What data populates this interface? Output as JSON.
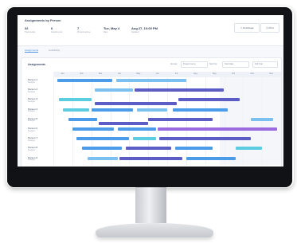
{
  "page_title": "Assignments by Person",
  "stats": [
    {
      "value": "32",
      "label": "Total people"
    },
    {
      "value": "6",
      "label": "Assignments"
    },
    {
      "value": "7",
      "label": "Projects active"
    },
    {
      "value": "Tue, May 4",
      "label": "Date"
    },
    {
      "value": "Aug 27, 10:00 PM",
      "label": "Updated"
    }
  ],
  "buttons": {
    "download": "Download",
    "print": "Print"
  },
  "tabs": [
    {
      "label": "Assignments"
    },
    {
      "label": "Availability"
    }
  ],
  "panel": {
    "title": "Assignments",
    "filter_label_1": "Group",
    "filter_value_1": "Project name",
    "filter_label_2": "Sort by",
    "filter_value_2": "Start date",
    "view_label": "Full Year"
  },
  "months": [
    "Jan",
    "Feb",
    "Mar",
    "Apr",
    "May",
    "Jun",
    "Jul",
    "Aug",
    "Sep",
    "Oct",
    "Nov",
    "Dec"
  ],
  "rows": [
    {
      "label": "Person 1",
      "sub": "Designer"
    },
    {
      "label": "Person 2",
      "sub": "Designer"
    },
    {
      "label": "Person 3",
      "sub": "Designer"
    },
    {
      "label": "Person 4",
      "sub": "Designer"
    },
    {
      "label": "Person 5",
      "sub": "Designer"
    },
    {
      "label": "Person 6",
      "sub": "Designer"
    },
    {
      "label": "Person 7",
      "sub": "Designer"
    },
    {
      "label": "Person 8",
      "sub": "Designer"
    },
    {
      "label": "Person 9",
      "sub": "Designer"
    }
  ],
  "colors": {
    "blue": "#4a9be8",
    "indigo": "#5b5cc4",
    "cyan": "#5ccde0",
    "purple": "#9a6be0",
    "light_blue": "#7cc0f0"
  }
}
